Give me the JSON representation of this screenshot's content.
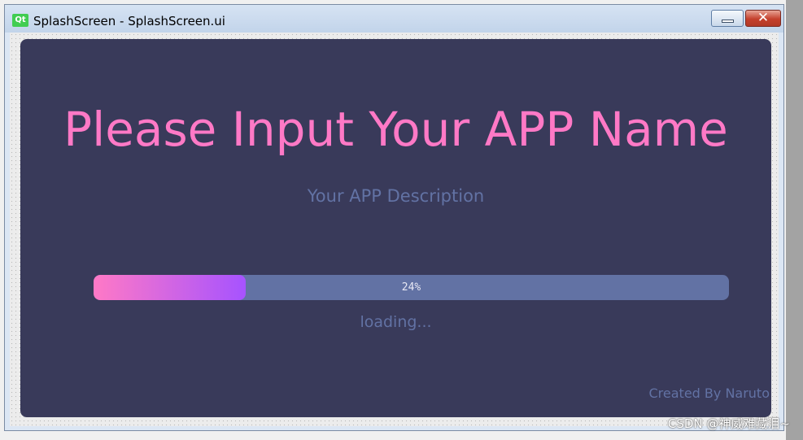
{
  "window": {
    "app_icon": "qt-logo-icon",
    "app_icon_text": "Qt",
    "title": "SplashScreen - SplashScreen.ui",
    "minimize_icon": "minimize-icon",
    "close_icon": "close-icon"
  },
  "splash": {
    "app_name": "Please Input Your APP Name",
    "app_description": "Your APP Description",
    "progress": {
      "value": 24,
      "label": "24%"
    },
    "loading_text": "loading...",
    "credits": "Created By Naruto"
  },
  "colors": {
    "splash_background": "#393a5a",
    "app_name": "#ff79c6",
    "secondary_text": "#6272a4",
    "progress_track": "#6272a4",
    "progress_gradient_start": "#ff79c6",
    "progress_gradient_end": "#a653ff"
  },
  "watermark": "CSDN @神威难藏泪~"
}
